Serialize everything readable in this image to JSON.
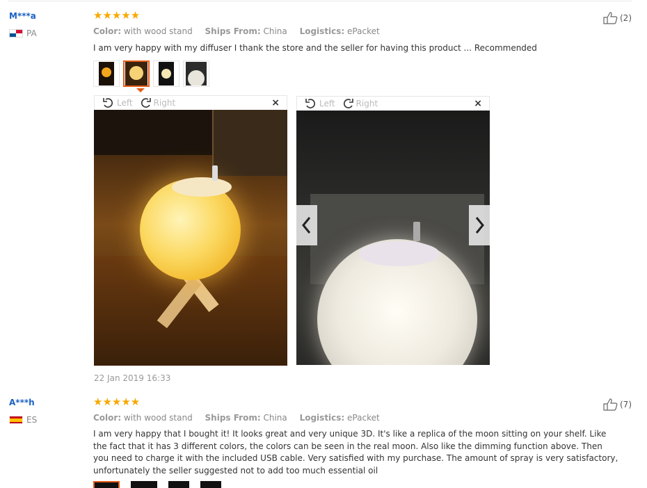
{
  "review1": {
    "user": "M***a",
    "country": "PA",
    "stars": "★★★★★",
    "color_label": "Color:",
    "color_value": "with wood stand",
    "ships_label": "Ships From:",
    "ships_value": "China",
    "logistics_label": "Logistics:",
    "logistics_value": "ePacket",
    "text": "I am very happy with my diffuser I thank the store and the seller for having this product ... Recommended",
    "helpful_count": "(2)",
    "viewer_left_label": "Left",
    "viewer_right_label": "Right",
    "viewer_close": "×",
    "date": "22 Jan 2019 16:33"
  },
  "review2": {
    "user": "A***h",
    "country": "ES",
    "stars": "★★★★★",
    "color_label": "Color:",
    "color_value": "with wood stand",
    "ships_label": "Ships From:",
    "ships_value": "China",
    "logistics_label": "Logistics:",
    "logistics_value": "ePacket",
    "text": "I am very happy that I bought it! It looks great and very unique 3D. It's like a replica of the moon sitting on your shelf. Like the fact that it has 3 different colors, the colors can be seen in the real moon. Also like the dimming function above. Then you need to charge it with the included USB cable. Very satisfied with my purchase. The amount of spray is very satisfactory, unfortunately the seller suggested not to add too much essential oil",
    "helpful_count": "(7)"
  },
  "colors": {
    "star": "#f7a800",
    "username": "#1c61c4",
    "active_thumb_border": "#e45d1b"
  },
  "icons": {
    "helpful": "thumbs-up-icon",
    "rotate_left": "rotate-left-icon",
    "rotate_right": "rotate-right-icon",
    "prev": "chevron-left-icon",
    "next": "chevron-right-icon",
    "close": "close-icon"
  }
}
